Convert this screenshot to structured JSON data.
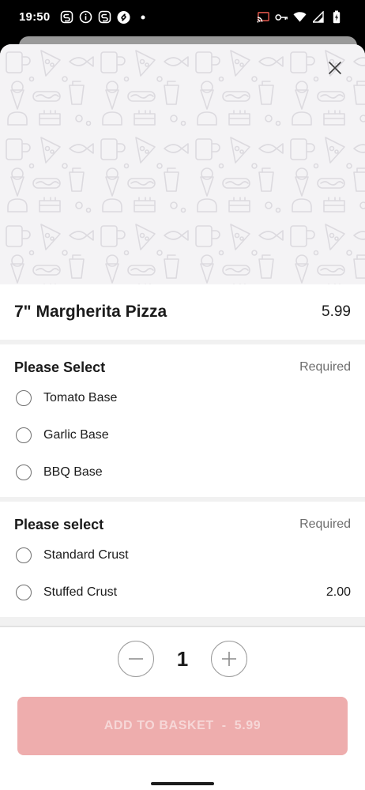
{
  "status_bar": {
    "time": "19:50",
    "left_icons": [
      "sync-s-icon",
      "info-icon",
      "sync-s-icon",
      "shazam-icon",
      "dot-icon"
    ],
    "right_icons": [
      "cast-icon",
      "key-icon",
      "wifi-icon",
      "signal-icon",
      "battery-charging-icon"
    ]
  },
  "item": {
    "name": "7\" Margherita Pizza",
    "price": "5.99"
  },
  "sections": [
    {
      "title": "Please Select",
      "requirement": "Required",
      "options": [
        {
          "label": "Tomato Base",
          "price": ""
        },
        {
          "label": "Garlic Base",
          "price": ""
        },
        {
          "label": "BBQ Base",
          "price": ""
        }
      ]
    },
    {
      "title": "Please select",
      "requirement": "Required",
      "options": [
        {
          "label": "Standard Crust",
          "price": ""
        },
        {
          "label": "Stuffed Crust",
          "price": "2.00"
        }
      ]
    }
  ],
  "quantity": {
    "value": "1",
    "decrement_icon": "minus-icon",
    "increment_icon": "plus-icon"
  },
  "add_button": {
    "label": "ADD TO BASKET",
    "separator": "-",
    "price": "5.99"
  },
  "colors": {
    "accent_disabled": "#eeadad",
    "accent_text_disabled": "#f6d7d7",
    "sheet_background": "#f1f1f1"
  }
}
